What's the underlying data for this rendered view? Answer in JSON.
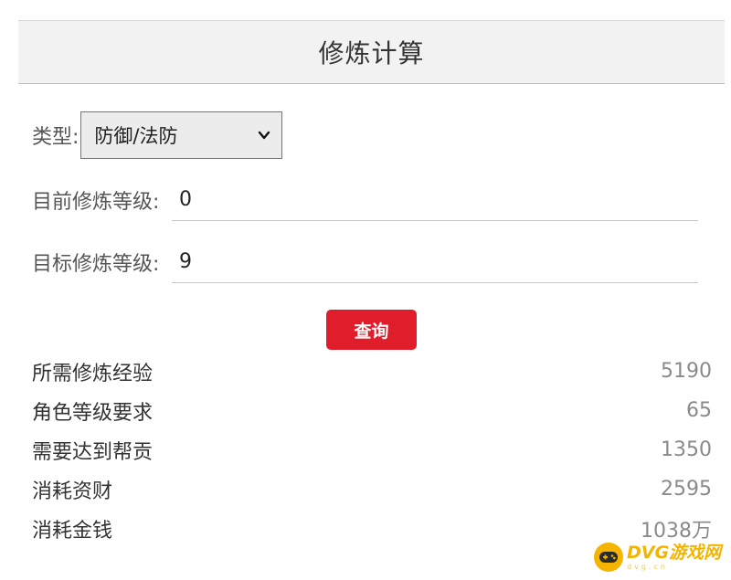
{
  "header": {
    "title": "修炼计算"
  },
  "form": {
    "type_label": "类型:",
    "type_value": "防御/法防",
    "current_label": "目前修炼等级:",
    "current_value": "0",
    "target_label": "目标修炼等级:",
    "target_value": "9",
    "query_label": "查询"
  },
  "results": [
    {
      "label": "所需修炼经验",
      "value": "5190"
    },
    {
      "label": "角色等级要求",
      "value": "65"
    },
    {
      "label": "需要达到帮贡",
      "value": "1350"
    },
    {
      "label": "消耗资财",
      "value": "2595"
    },
    {
      "label": "消耗金钱",
      "value": "1038万"
    }
  ],
  "watermark": {
    "text": "DVG游戏网",
    "sub": "dvg.cn"
  },
  "colors": {
    "accent": "#e01e2b",
    "header_bg": "#f2f2f2",
    "watermark": "#f5b400"
  },
  "icons": {
    "select_arrow": "chevron-down-icon",
    "logo": "gamepad-icon"
  }
}
